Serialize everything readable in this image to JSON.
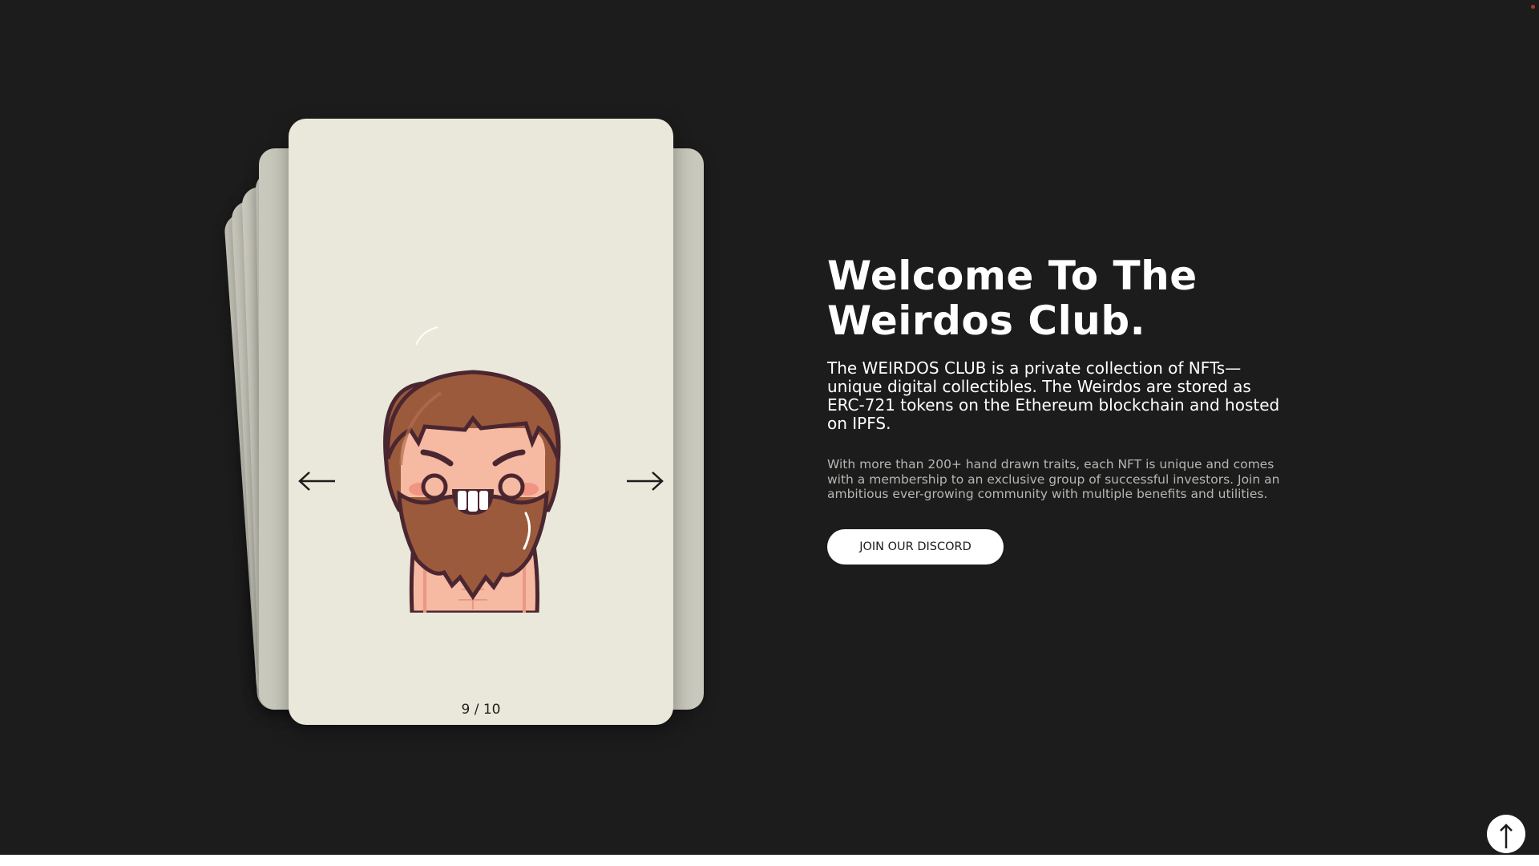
{
  "carousel": {
    "counter": "9 / 10",
    "prev_icon": "arrow-left-icon",
    "next_icon": "arrow-right-icon"
  },
  "hero": {
    "headline": "Welcome To The Weirdos Club.",
    "intro": "The WEIRDOS CLUB is a private collection of NFTs—unique digital collectibles. The Weirdos are stored as ERC-721 tokens on the Ethereum blockchain and hosted on IPFS.",
    "detail": "With more than 200+ hand drawn traits, each NFT is unique and comes with a membership to an exclusive group of successful investors. Join an ambitious ever-growing community with multiple benefits and utilities.",
    "cta_label": "JOIN OUR DISCORD"
  },
  "scroll_top": {
    "icon": "arrow-up-icon"
  },
  "colors": {
    "background": "#1c1c1c",
    "card": "#eae8da",
    "card_back": "#c9c8bc",
    "hair": "#9c5a3c",
    "skin": "#f6b9a2",
    "outline": "#4a2630"
  }
}
